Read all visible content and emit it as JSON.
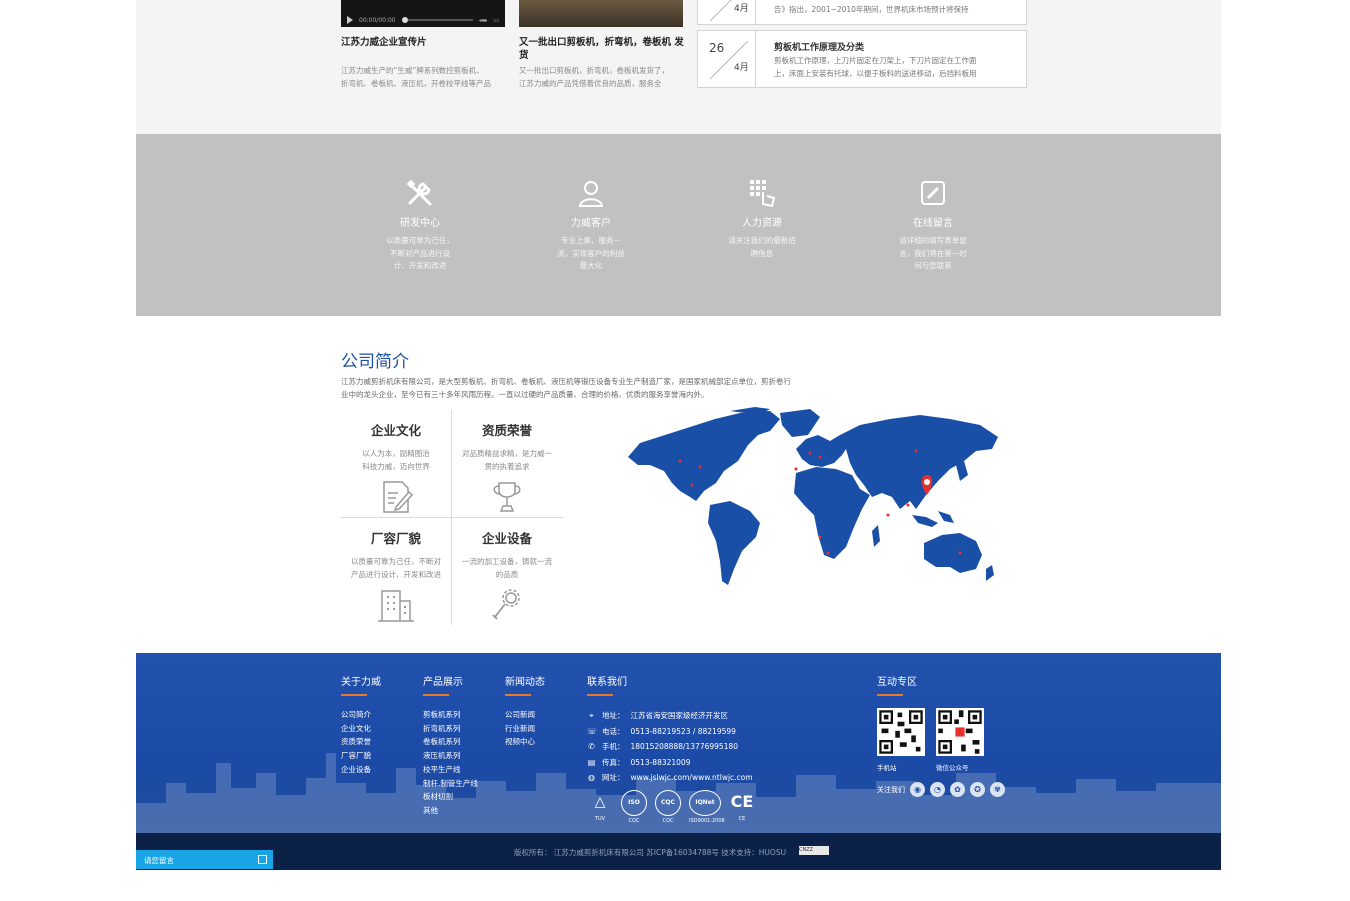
{
  "news": {
    "video_time": "00:00/00:00",
    "items": [
      {
        "title": "江苏力威企业宣传片",
        "desc": [
          "江苏力威生产的“生威”牌系列数控剪板机、",
          "折弯机、卷板机、液压机，开卷校平线等产品"
        ]
      },
      {
        "title": "又一批出口剪板机，折弯机，卷板机 发货",
        "desc": [
          "又一批出口剪板机，折弯机，卷板机发货了，",
          "江苏力威的产品凭借着优良的品质，服务全"
        ]
      }
    ],
    "dated": [
      {
        "month": "4月",
        "text": "告》指出，2001~2010年期间，世界机床市场预计将保持"
      },
      {
        "day": "26",
        "month": "4月",
        "title": "剪板机工作原理及分类",
        "text": [
          "剪板机工作原理，上刀片固定在刀架上，下刀片固定在工作面",
          "上，床面上安装有托球，以便于板料的送进移动，后挡料板用"
        ]
      }
    ]
  },
  "services": [
    {
      "icon": "tools-icon",
      "title": "研发中心",
      "desc": [
        "以质量可靠为己任，",
        "不断对产品进行设",
        "计、开发和改进"
      ]
    },
    {
      "icon": "user-icon",
      "title": "力威客户",
      "desc": [
        "专业上乘，服务一",
        "流，实现客户的利益",
        "最大化"
      ]
    },
    {
      "icon": "grid-hand-icon",
      "title": "人力资源",
      "desc": [
        "请关注我们的最新招",
        "聘信息"
      ]
    },
    {
      "icon": "edit-icon",
      "title": "在线留言",
      "desc": [
        "请详细的填写表单留",
        "言，我们将在第一时",
        "间与您联系"
      ]
    }
  ],
  "about": {
    "title": "公司简介",
    "desc": [
      "江苏力威剪折机床有限公司，是大型剪板机、折弯机、卷板机、液压机等锻压设备专业生产制造厂家，是国家机械部定点单位，剪折卷行",
      "业中的龙头企业，至今已有三十多年风雨历程。一直以过硬的产品质量、合理的价格、优质的服务享誉海内外。"
    ],
    "cells": [
      {
        "title": "企业文化",
        "desc": [
          "以人为本，励精图治",
          "科技力威，迈向世界"
        ],
        "icon": "document-edit-icon"
      },
      {
        "title": "资质荣誉",
        "desc": [
          "对品质精益求精，是力威一",
          "贯的执着追求"
        ],
        "icon": "trophy-icon"
      },
      {
        "title": "厂容厂貌",
        "desc": [
          "以质量可靠为己任，不断对",
          "产品进行设计、开发和改进"
        ],
        "icon": "building-icon"
      },
      {
        "title": "企业设备",
        "desc": [
          "一流的加工设备，铸就一流",
          "的品质"
        ],
        "icon": "gear-wrench-icon"
      }
    ]
  },
  "footer": {
    "columns": [
      {
        "heading": "关于力威",
        "items": [
          "公司简介",
          "企业文化",
          "资质荣誉",
          "厂容厂貌",
          "企业设备"
        ]
      },
      {
        "heading": "产品展示",
        "items": [
          "剪板机系列",
          "折弯机系列",
          "卷板机系列",
          "液压机系列",
          "校平生产线",
          "制杆.制管生产线",
          "板材切割",
          "其他"
        ]
      },
      {
        "heading": "新闻动态",
        "items": [
          "公司新闻",
          "行业新闻",
          "视频中心"
        ]
      }
    ],
    "contact": {
      "heading": "联系我们",
      "rows": [
        {
          "icon": "location-icon",
          "label": "地址：",
          "value": "江苏省海安国家级经济开发区"
        },
        {
          "icon": "phone-icon",
          "label": "电话：",
          "value": "0513-88219523 / 88219599"
        },
        {
          "icon": "mobile-icon",
          "label": "手机：",
          "value": "18015208888/13776995180"
        },
        {
          "icon": "fax-icon",
          "label": "传真：",
          "value": "0513-88321009"
        },
        {
          "icon": "globe-icon",
          "label": "网址：",
          "value": "www.jslwjc.com/www.ntlwjc.com"
        }
      ],
      "certs": [
        {
          "mark": "TÜV",
          "label": "TUV"
        },
        {
          "mark": "ISO",
          "label": "CQC"
        },
        {
          "mark": "CQC",
          "label": "CQC"
        },
        {
          "mark": "IQNet",
          "label": "ISO9001:2008"
        },
        {
          "mark": "CE",
          "label": "CE"
        }
      ]
    },
    "interact": {
      "heading": "互动专区",
      "qr": [
        {
          "label": "手机站"
        },
        {
          "label": "微信公众号"
        }
      ],
      "follow": "关注我们"
    }
  },
  "bottom": {
    "copyright": "版权所有：  江苏力威剪折机床有限公司   苏ICP备16034788号   技术支持：HUOSU",
    "badge": "CNZZ"
  },
  "message_tab": "请您留言"
}
